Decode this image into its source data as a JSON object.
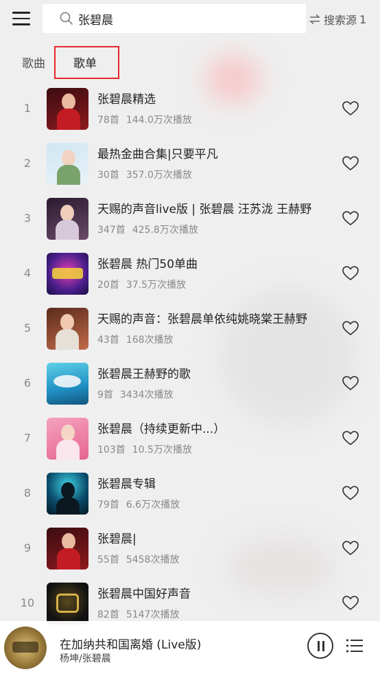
{
  "search": {
    "query": "张碧晨"
  },
  "source_button": {
    "label": "搜索源",
    "count": "1"
  },
  "tabs": [
    {
      "label": "歌曲",
      "active": false
    },
    {
      "label": "歌单",
      "active": true
    }
  ],
  "playlists": [
    {
      "index": "1",
      "title": "张碧晨精选",
      "count": "78首",
      "plays": "144.0万次播放"
    },
    {
      "index": "2",
      "title": "最热金曲合集|只要平凡",
      "count": "30首",
      "plays": "357.0万次播放"
    },
    {
      "index": "3",
      "title": "天赐的声音live版 | 张碧晨 汪苏泷 王赫野",
      "count": "347首",
      "plays": "425.8万次播放"
    },
    {
      "index": "4",
      "title": "张碧晨 热门50单曲",
      "count": "20首",
      "plays": "37.5万次播放"
    },
    {
      "index": "5",
      "title": "天赐的声音：张碧晨单依纯姚晓棠王赫野",
      "count": "43首",
      "plays": "168次播放"
    },
    {
      "index": "6",
      "title": "张碧晨王赫野的歌",
      "count": "9首",
      "plays": "3434次播放"
    },
    {
      "index": "7",
      "title": "张碧晨（持续更新中...）",
      "count": "103首",
      "plays": "10.5万次播放"
    },
    {
      "index": "8",
      "title": "张碧晨专辑",
      "count": "79首",
      "plays": "6.6万次播放"
    },
    {
      "index": "9",
      "title": "张碧晨|",
      "count": "55首",
      "plays": "5458次播放"
    },
    {
      "index": "10",
      "title": "张碧晨中国好声音",
      "count": "82首",
      "plays": "5147次播放"
    }
  ],
  "player": {
    "title": "在加纳共和国离婚 (Live版)",
    "artist": "杨坤/张碧晨"
  },
  "colors": {
    "accent_red": "#e8272b",
    "background": "#efefef"
  }
}
